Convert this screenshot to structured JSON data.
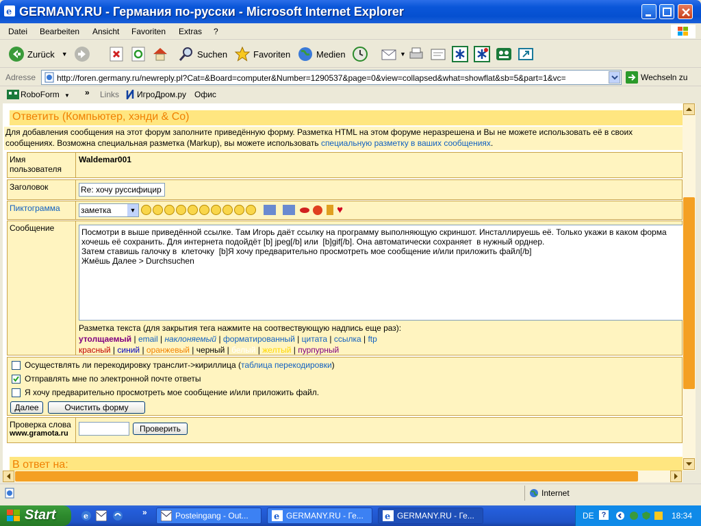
{
  "window": {
    "title": "GERMANY.RU - Германия по-русски - Microsoft Internet Explorer"
  },
  "menu": [
    "Datei",
    "Bearbeiten",
    "Ansicht",
    "Favoriten",
    "Extras",
    "?"
  ],
  "toolbar": {
    "back": "Zurück",
    "search": "Suchen",
    "favorites": "Favoriten",
    "media": "Medien"
  },
  "address": {
    "label": "Adresse",
    "url": "http://foren.germany.ru/newreply.pl?Cat=&Board=computer&Number=1290537&page=0&view=collapsed&what=showflat&sb=5&part=1&vc=",
    "go_label": "Wechseln zu"
  },
  "links": {
    "roboform": "RoboForm",
    "links_label": "Links",
    "items": [
      "ИгроДром.ру",
      "Офис"
    ]
  },
  "form": {
    "heading": "Ответить (Компьютер, хэнди & Co)",
    "intro_text": "Для добавления сообщения на этот форум заполните приведённую форму. Разметка HTML на этом форуме неразрешена и Вы не можете использовать её в своих сообщениях. Возможна специальная разметка (Markup), вы можете использовать ",
    "intro_link": "специальную разметку в ваших сообщениях",
    "intro_end": ".",
    "username_label": "Имя пользователя",
    "username_value": "Waldemar001",
    "subject_label": "Заголовок",
    "subject_value": "Re: хочу руссифицир",
    "icon_label": "Пиктограмма",
    "icon_select": "заметка",
    "message_label": "Сообщение",
    "message_text": "Посмотри в выше приведённой ссылке. Там Игорь даёт ссылку на программу выполняющую скриншот. Инсталлируешь её. Только укажи в каком форма\nхочешь её сохранить. Для интернета подойдёт [b] jpeg[/b] или  [b]gif[/b]. Она автоматически сохраняет  в нужный орднер.\nЗатем ставишь галочку в  клеточку  [b]Я хочу предварительно просмотреть мое сообщение и/или приложить файл[/b]\nЖмёшь Далее > Durchsuchen",
    "markup_hint": "Разметка текста (для закрытия тега нажмите на соотвествующую надпись еще раз):",
    "markup_tags": [
      "утолщаемый",
      "email",
      "наклоняемый",
      "форматированный",
      "цитата",
      "ссылка",
      "ftp"
    ],
    "colors": [
      "красный",
      "синий",
      "оранжевый",
      "черный",
      "белый",
      "желтый",
      "пурпурный"
    ],
    "color_values": [
      "#c00000",
      "#0000c0",
      "#f08000",
      "#000000",
      "#ffffff",
      "#ffd800",
      "#800080"
    ],
    "translit_text": "Осуществлять ли перекодировку транслит->кириллица (",
    "translit_link": "таблица перекодировки",
    "translit_end": ")",
    "email_replies": "Отправлять мне по электронной почте ответы",
    "preview_text": "Я хочу предварительно просмотреть мое сообщение и/или приложить файл.",
    "next_button": "Далее",
    "clear_button": "Очистить форму",
    "spell_label": "Проверка слова",
    "spell_site": "www.gramota.ru",
    "spell_button": "Проверить",
    "reply_to": "В ответ на:"
  },
  "status": {
    "zone": "Internet"
  },
  "taskbar": {
    "start": "Start",
    "tasks": [
      "Posteingang - Out...",
      "GERMANY.RU - Ге...",
      "GERMANY.RU - Ге..."
    ],
    "lang": "DE",
    "time": "18:34"
  },
  "colors": {
    "accent": "#f4a023",
    "panel": "#fff4c0",
    "link": "#1060c0"
  }
}
